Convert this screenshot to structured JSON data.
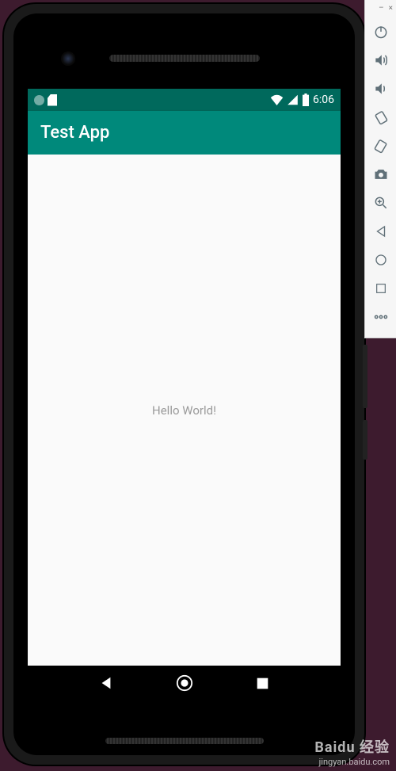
{
  "status_bar": {
    "time": "6:06"
  },
  "app": {
    "title": "Test App",
    "content_text": "Hello World!"
  },
  "emulator_window": {
    "minimize": "–",
    "close": "×"
  },
  "watermark": {
    "brand": "Baidu 经验",
    "url": "jingyan.baidu.com"
  }
}
